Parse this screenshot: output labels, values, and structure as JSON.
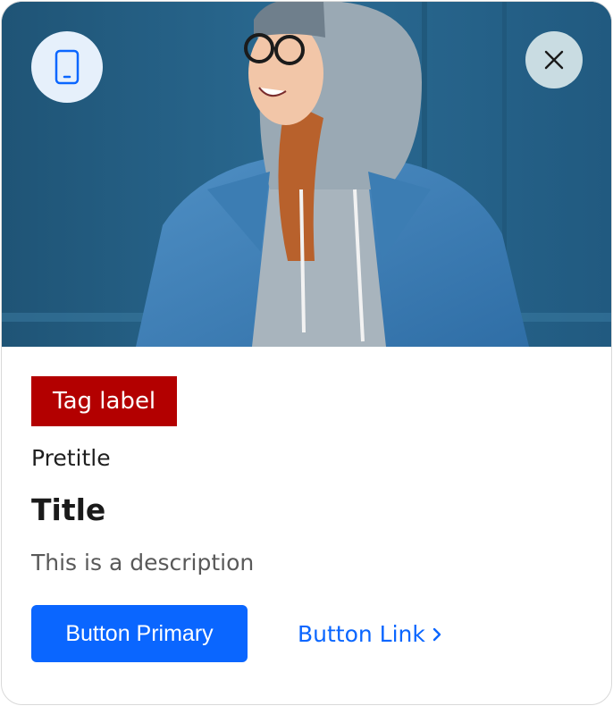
{
  "card": {
    "hero_image": "woman in grey hoodie and denim jacket smiling against blue wall",
    "device_icon": "smartphone-icon",
    "close_icon": "close-icon",
    "tag_label": "Tag label",
    "pretitle": "Pretitle",
    "title": "Title",
    "description": "This is a description",
    "primary_button_label": "Button Primary",
    "link_button_label": "Button Link",
    "link_button_icon": "chevron-right-icon"
  },
  "colors": {
    "tag_background": "#b30000",
    "primary": "#0a66ff",
    "hero_background": "#245b80",
    "device_badge_background": "#e6f0fb",
    "close_button_background": "#c9dce2"
  }
}
